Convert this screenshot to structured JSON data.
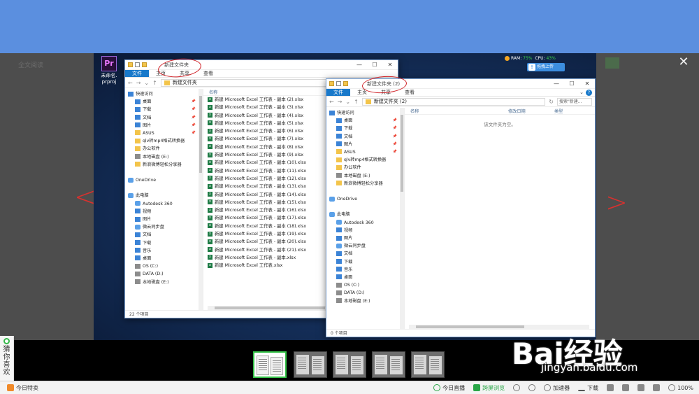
{
  "viewer": {
    "ghost_title": "全文阅读",
    "close_glyph": "✕",
    "arrow_left": "<",
    "arrow_right": ">"
  },
  "desktop": {
    "icon_label_line1": "未命名.",
    "icon_label_line2": "prproj",
    "icon_logo": "Pr",
    "ram_label": "RAM:",
    "ram_value": "75%",
    "cpu_label": "CPU:",
    "cpu_value": "43%",
    "upload_label": "拖拽上传"
  },
  "win1": {
    "title": "新建文件夹",
    "ribbon": [
      "文件",
      "主页",
      "共享",
      "查看"
    ],
    "address": "新建文件夹",
    "column_name": "名称",
    "nav": [
      {
        "label": "快速访问",
        "icon": "star-icon"
      },
      {
        "label": "桌面",
        "icon": "desktop-icon"
      },
      {
        "label": "下载",
        "icon": "download-icon"
      },
      {
        "label": "文档",
        "icon": "document-icon"
      },
      {
        "label": "图片",
        "icon": "picture-icon"
      },
      {
        "label": "ASUS",
        "icon": "folder-icon"
      },
      {
        "label": "qlv转mp4格式转换器",
        "icon": "folder-icon"
      },
      {
        "label": "办公软件",
        "icon": "folder-icon"
      },
      {
        "label": "本地磁盘 (E:)",
        "icon": "drive-icon"
      },
      {
        "label": "新浪微博轻松分享器",
        "icon": "folder-icon"
      },
      {
        "label": "",
        "icon": ""
      },
      {
        "label": "OneDrive",
        "icon": "cloud-icon"
      },
      {
        "label": "",
        "icon": ""
      },
      {
        "label": "此电脑",
        "icon": "computer-icon"
      },
      {
        "label": "Autodesk 360",
        "icon": "cloud-icon"
      },
      {
        "label": "视频",
        "icon": "video-icon"
      },
      {
        "label": "图片",
        "icon": "picture-icon"
      },
      {
        "label": "微云同步盘",
        "icon": "cloud-icon"
      },
      {
        "label": "文档",
        "icon": "document-icon"
      },
      {
        "label": "下载",
        "icon": "download-icon"
      },
      {
        "label": "音乐",
        "icon": "music-icon"
      },
      {
        "label": "桌面",
        "icon": "desktop-icon"
      },
      {
        "label": "OS (C:)",
        "icon": "drive-icon"
      },
      {
        "label": "DATA (D:)",
        "icon": "drive-icon"
      },
      {
        "label": "本地磁盘 (E:)",
        "icon": "drive-icon"
      }
    ],
    "files": [
      "新建 Microsoft Excel 工作表 - 副本 (2).xlsx",
      "新建 Microsoft Excel 工作表 - 副本 (3).xlsx",
      "新建 Microsoft Excel 工作表 - 副本 (4).xlsx",
      "新建 Microsoft Excel 工作表 - 副本 (5).xlsx",
      "新建 Microsoft Excel 工作表 - 副本 (6).xlsx",
      "新建 Microsoft Excel 工作表 - 副本 (7).xlsx",
      "新建 Microsoft Excel 工作表 - 副本 (8).xlsx",
      "新建 Microsoft Excel 工作表 - 副本 (9).xlsx",
      "新建 Microsoft Excel 工作表 - 副本 (10).xlsx",
      "新建 Microsoft Excel 工作表 - 副本 (11).xlsx",
      "新建 Microsoft Excel 工作表 - 副本 (12).xlsx",
      "新建 Microsoft Excel 工作表 - 副本 (13).xlsx",
      "新建 Microsoft Excel 工作表 - 副本 (14).xlsx",
      "新建 Microsoft Excel 工作表 - 副本 (15).xlsx",
      "新建 Microsoft Excel 工作表 - 副本 (16).xlsx",
      "新建 Microsoft Excel 工作表 - 副本 (17).xlsx",
      "新建 Microsoft Excel 工作表 - 副本 (18).xlsx",
      "新建 Microsoft Excel 工作表 - 副本 (19).xlsx",
      "新建 Microsoft Excel 工作表 - 副本 (20).xlsx",
      "新建 Microsoft Excel 工作表 - 副本 (21).xlsx",
      "新建 Microsoft Excel 工作表 - 副本.xlsx",
      "新建 Microsoft Excel 工作表.xlsx"
    ],
    "status": "22 个项目"
  },
  "win2": {
    "title": "新建文件夹 (2)",
    "ribbon": [
      "文件",
      "主页",
      "共享",
      "查看"
    ],
    "address": "新建文件夹 (2)",
    "search_placeholder": "搜索\"新建...",
    "columns": [
      "名称",
      "修改日期",
      "类型"
    ],
    "empty": "该文件夹为空。",
    "nav": [
      {
        "label": "快速访问",
        "icon": "star-icon"
      },
      {
        "label": "桌面",
        "icon": "desktop-icon"
      },
      {
        "label": "下载",
        "icon": "download-icon"
      },
      {
        "label": "文档",
        "icon": "document-icon"
      },
      {
        "label": "图片",
        "icon": "picture-icon"
      },
      {
        "label": "ASUS",
        "icon": "folder-icon"
      },
      {
        "label": "qlv转mp4格式转换器",
        "icon": "folder-icon"
      },
      {
        "label": "办公软件",
        "icon": "folder-icon"
      },
      {
        "label": "本地磁盘 (E:)",
        "icon": "drive-icon"
      },
      {
        "label": "新浪微博轻松分享器",
        "icon": "folder-icon"
      },
      {
        "label": "",
        "icon": ""
      },
      {
        "label": "OneDrive",
        "icon": "cloud-icon"
      },
      {
        "label": "",
        "icon": ""
      },
      {
        "label": "此电脑",
        "icon": "computer-icon"
      },
      {
        "label": "Autodesk 360",
        "icon": "cloud-icon"
      },
      {
        "label": "视频",
        "icon": "video-icon"
      },
      {
        "label": "图片",
        "icon": "picture-icon"
      },
      {
        "label": "微云同步盘",
        "icon": "cloud-icon"
      },
      {
        "label": "文档",
        "icon": "document-icon"
      },
      {
        "label": "下载",
        "icon": "download-icon"
      },
      {
        "label": "音乐",
        "icon": "music-icon"
      },
      {
        "label": "桌面",
        "icon": "desktop-icon"
      },
      {
        "label": "OS (C:)",
        "icon": "drive-icon"
      },
      {
        "label": "DATA (D:)",
        "icon": "drive-icon"
      },
      {
        "label": "本地磁盘 (E:)",
        "icon": "drive-icon"
      }
    ],
    "status": "0 个项目"
  },
  "side": {
    "guess_text": "猜你喜欢"
  },
  "statusbar": {
    "today_deals": "今日特卖",
    "live": "今日直播",
    "cross_screen": "跨屏浏览",
    "accelerator": "加速器",
    "download": "下载",
    "zoom": "100%"
  },
  "watermark": {
    "brand": "Bai经验",
    "url": "jingyan.baidu.com"
  },
  "colors": {
    "top_bar": "#5b8fdf",
    "accent_blue": "#1979ca",
    "annotation_red": "#cf2127",
    "active_green": "#35c248"
  }
}
